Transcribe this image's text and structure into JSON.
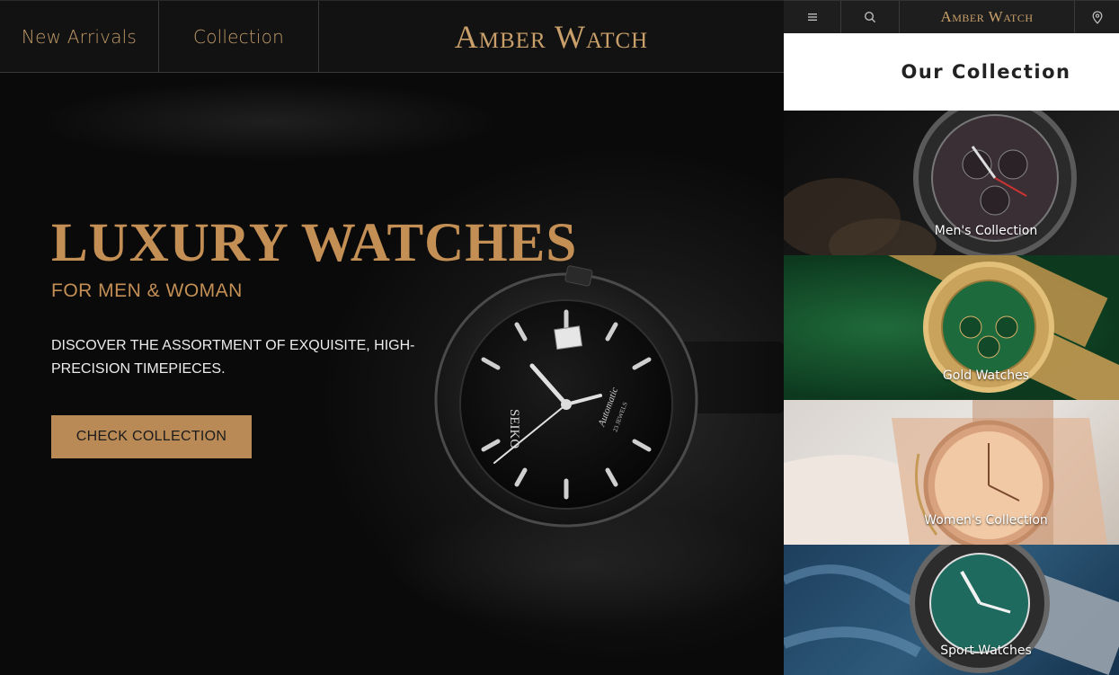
{
  "nav": {
    "items": [
      "New Arrivals",
      "Collection"
    ],
    "brand": "Amber Watch"
  },
  "hero": {
    "title": "LUXURY WATCHES",
    "subtitle": "FOR MEN & WOMAN",
    "description": "DISCOVER THE ASSORTMENT OF EXQUISITE, HIGH-PRECISION TIMEPIECES.",
    "cta_label": "CHECK COLLECTION",
    "watch_dial_brand": "SEIKO",
    "watch_dial_model": "Automatic",
    "watch_dial_jewels": "23 JEWELS"
  },
  "side": {
    "topbar": {
      "menu_icon": "menu-icon",
      "search_icon": "search-icon",
      "brand": "Amber Watch",
      "location_icon": "location-pin-icon"
    },
    "heading": "Our Collection",
    "tiles": [
      {
        "label": "Men's Collection"
      },
      {
        "label": "Gold Watches"
      },
      {
        "label": "Women's Collection"
      },
      {
        "label": "Sport Watches"
      }
    ]
  },
  "colors": {
    "accent": "#c48f55",
    "button": "#b98a55",
    "nav_bg": "#141414"
  }
}
